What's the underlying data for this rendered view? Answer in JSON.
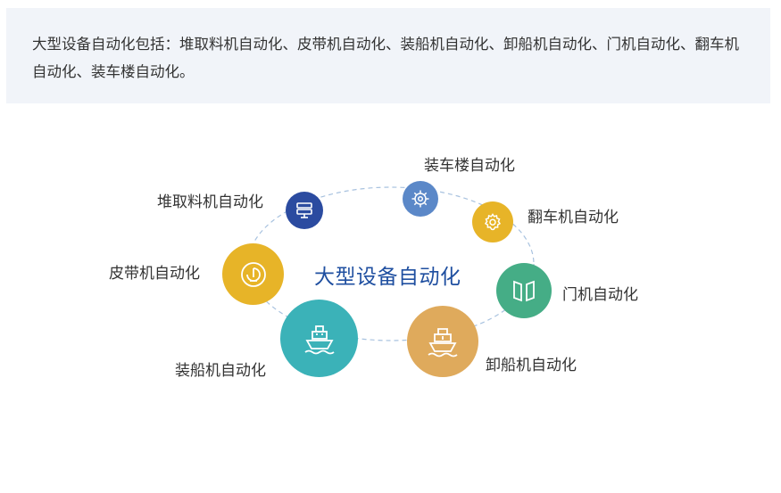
{
  "intro": {
    "text": "大型设备自动化包括：堆取料机自动化、皮带机自动化、装船机自动化、卸船机自动化、门机自动化、翻车机自动化、装车楼自动化。"
  },
  "diagram": {
    "center_title": "大型设备自动化",
    "nodes": [
      {
        "label": "堆取料机自动化",
        "icon": "stacker-reclaimer-icon",
        "color": "#2b4ba0"
      },
      {
        "label": "装车楼自动化",
        "icon": "gear-cog-icon",
        "color": "#5b88c8"
      },
      {
        "label": "翻车机自动化",
        "icon": "gear-icon",
        "color": "#e7b428"
      },
      {
        "label": "皮带机自动化",
        "icon": "belt-roller-icon",
        "color": "#e7b428"
      },
      {
        "label": "门机自动化",
        "icon": "gate-icon",
        "color": "#45ad86"
      },
      {
        "label": "装船机自动化",
        "icon": "ship-icon",
        "color": "#3bb2b8"
      },
      {
        "label": "卸船机自动化",
        "icon": "ship-unload-icon",
        "color": "#dfaa5c"
      }
    ],
    "orbit_color": "#a8c2df"
  }
}
